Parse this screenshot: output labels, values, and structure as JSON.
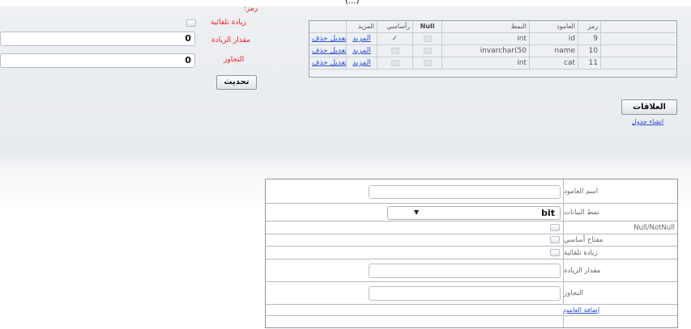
{
  "window": {
    "title": "(...)"
  },
  "props": {
    "header_label": "رمز:",
    "auto_increment_label": "زيادة تلقائية",
    "increment_label": "مقدار الزيادة",
    "increment_value": "0",
    "seed_label": "التجاوز",
    "seed_value": "0",
    "update_button": "تحديث"
  },
  "columns_table": {
    "headers": [
      "",
      "رمز",
      "العامود",
      "النمط",
      "Null",
      "رأساسي",
      "المزيد"
    ],
    "rows": [
      {
        "actions": "تعديل حذف",
        "id": "9",
        "name": "id",
        "type": "int",
        "null": false,
        "primary": true,
        "more": "المزيد"
      },
      {
        "actions": "تعديل حذف",
        "id": "10",
        "name": "name",
        "type": "invarchar(50",
        "null": false,
        "primary": false,
        "more": "المزيد"
      },
      {
        "actions": "تعديل حذف",
        "id": "11",
        "name": "cat",
        "type": "int",
        "null": false,
        "primary": false,
        "more": "المزيد"
      }
    ]
  },
  "relations": {
    "button": "العلاقات",
    "create_link": "انشاء جدول"
  },
  "form": {
    "column_name_label": "اسم العامود",
    "data_type_label": "نمط البيانات",
    "data_type_value": "bit",
    "null_label": "Null/NotNull",
    "primary_key_label": "مفتاح أساسي",
    "auto_increment_label": "زيادة تلقائية",
    "increment_label": "مقدار الزيادة",
    "seed_label": "التجاوز",
    "add_link": "إضافة العامود"
  },
  "icons": {
    "check": "checkmark-icon",
    "dropdown": "caret-down-icon"
  }
}
